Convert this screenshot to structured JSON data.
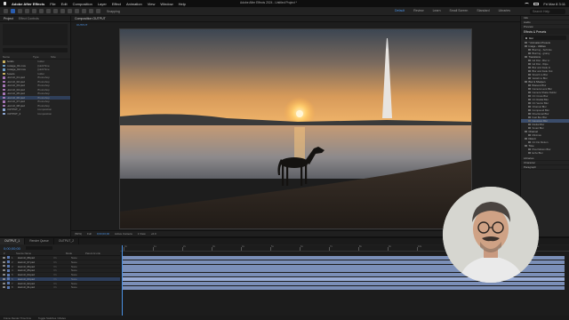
{
  "menubar": {
    "apple": "",
    "app_name": "Adobe After Effects",
    "items": [
      "File",
      "Edit",
      "Composition",
      "Layer",
      "Effect",
      "Animation",
      "View",
      "Window",
      "Help"
    ],
    "clock": "Fri Mar 8  3:11"
  },
  "toolbar": {
    "title": "Adobe After Effects 2024 - Untitled Project *",
    "snapping": "Snapping",
    "workspaces": [
      "Default",
      "Review",
      "Learn",
      "Small Screen",
      "Standard",
      "Libraries"
    ],
    "active_workspace": "Default",
    "search_placeholder": "Search Help"
  },
  "project": {
    "tab": "Project",
    "tab2": "Effect Controls",
    "columns": [
      "Name",
      "Type",
      "Size"
    ],
    "rows": [
      {
        "name": "Solids",
        "type": "Folder",
        "color": "#c9b25e"
      },
      {
        "name": "footage_01.mov",
        "type": "QuickTime",
        "color": "#6fa0c7"
      },
      {
        "name": "footage_02.mov",
        "type": "QuickTime",
        "color": "#6fa0c7"
      },
      {
        "name": "Assets",
        "type": "Folder",
        "color": "#c9b25e"
      },
      {
        "name": "Hormiz_01.psd",
        "type": "Photoshop",
        "color": "#a776b8"
      },
      {
        "name": "Hormiz_02.psd",
        "type": "Photoshop",
        "color": "#a776b8"
      },
      {
        "name": "Hormiz_03.psd",
        "type": "Photoshop",
        "color": "#a776b8"
      },
      {
        "name": "Hormiz_04.psd",
        "type": "Photoshop",
        "color": "#a776b8"
      },
      {
        "name": "Hormiz_05.psd",
        "type": "Photoshop",
        "color": "#a776b8"
      },
      {
        "name": "Hormiz_06.psd",
        "type": "Photoshop",
        "color": "#a776b8"
      },
      {
        "name": "Hormiz_07.psd",
        "type": "Photoshop",
        "color": "#a776b8"
      },
      {
        "name": "Hormiz_08.psd",
        "type": "Photoshop",
        "color": "#a776b8"
      },
      {
        "name": "OUTPUT_1",
        "type": "Composition",
        "color": "#8fa9d6"
      },
      {
        "name": "OUTPUT_2",
        "type": "Composition",
        "color": "#8fa9d6"
      }
    ]
  },
  "viewer": {
    "tab": "Composition OUTPUT",
    "comp_name": "OUTPUT",
    "footer": [
      "(50%)",
      "Full",
      "0;00;00;00",
      "Active Camera",
      "1 View",
      "+0.0"
    ]
  },
  "effects": {
    "panels": [
      "Info",
      "Audio",
      "Preview"
    ],
    "heading": "Effects & Presets",
    "search_value": "blur",
    "items": [
      {
        "label": "* Animation Presets",
        "folder": true
      },
      {
        "label": "Image - Utilities",
        "folder": true
      },
      {
        "label": "Blurring - Soft Glo",
        "folder": false
      },
      {
        "label": "Blurring - grainy",
        "folder": false
      },
      {
        "label": "Transitions",
        "folder": true
      },
      {
        "label": "Gd Dist - Blur Lr",
        "folder": false
      },
      {
        "label": "Gd Dist - Wipe",
        "folder": false
      },
      {
        "label": "Blur and Fade In",
        "folder": false
      },
      {
        "label": "Blur and Fade Out",
        "folder": false
      },
      {
        "label": "Stretch to Blur",
        "folder": false
      },
      {
        "label": "Vanish to Blur",
        "folder": false
      },
      {
        "label": "Blur & Sharpen",
        "folder": true
      },
      {
        "label": "Bilateral Blur",
        "folder": false
      },
      {
        "label": "Camera Lens Blur",
        "folder": false
      },
      {
        "label": "Camera Shake Deblur",
        "folder": false
      },
      {
        "label": "CC Cross Blur",
        "folder": false
      },
      {
        "label": "CC Radial Blur",
        "folder": false
      },
      {
        "label": "CC Vector Blur",
        "folder": false
      },
      {
        "label": "Channel Blur",
        "folder": false
      },
      {
        "label": "Compound Blur",
        "folder": false
      },
      {
        "label": "Directional Blur",
        "folder": false
      },
      {
        "label": "Fast Box Blur",
        "folder": false
      },
      {
        "label": "Gaussian Blur",
        "folder": false
      },
      {
        "label": "Radial Blur",
        "folder": false
      },
      {
        "label": "Smart Blur",
        "folder": false
      },
      {
        "label": "Channel",
        "folder": true
      },
      {
        "label": "Minimax",
        "folder": false
      },
      {
        "label": "Distort",
        "folder": true
      },
      {
        "label": "CC Flo Motion",
        "folder": false
      },
      {
        "label": "Time",
        "folder": true
      },
      {
        "label": "Pixel Motion Blur",
        "folder": false
      },
      {
        "label": "Echo Blur",
        "folder": false
      }
    ],
    "selected_item": "Gaussian Blur",
    "bottom": [
      "Libraries",
      "Character",
      "Paragraph"
    ]
  },
  "timeline": {
    "tabs": [
      "OUTPUT_1",
      "Render Queue",
      "OUTPUT_2"
    ],
    "active_tab": "OUTPUT_1",
    "timecode": "0;00;00;00",
    "layer_columns": [
      "#",
      "Source Name",
      "Mode",
      "Parent & Link"
    ],
    "layers": [
      {
        "idx": "1",
        "name": "Hormiz_08.psd",
        "par": "None"
      },
      {
        "idx": "2",
        "name": "Hormiz_07.psd",
        "par": "None"
      },
      {
        "idx": "3",
        "name": "Hormiz_06.psd",
        "par": "None"
      },
      {
        "idx": "4",
        "name": "Hormiz_05.psd",
        "par": "None"
      },
      {
        "idx": "5",
        "name": "Hormiz_04.psd",
        "par": "None"
      },
      {
        "idx": "6",
        "name": "Hormiz_03.psd",
        "par": "None"
      },
      {
        "idx": "7",
        "name": "Hormiz_02.psd",
        "par": "None"
      },
      {
        "idx": "8",
        "name": "Hormiz_01.psd",
        "par": "None"
      }
    ],
    "selected_layer": "6",
    "ruler_labels": [
      "0s",
      "1s",
      "2s",
      "3s",
      "4s",
      "5s",
      "6s",
      "7s",
      "8s",
      "9s",
      "10s",
      "11s",
      "12s",
      "13s",
      "14s"
    ],
    "footer": [
      "Frame Render Time 0ms",
      "Toggle Switches / Modes"
    ]
  },
  "colors": {
    "accent": "#4a90e2",
    "layer_bar": "#7b8fb8"
  }
}
